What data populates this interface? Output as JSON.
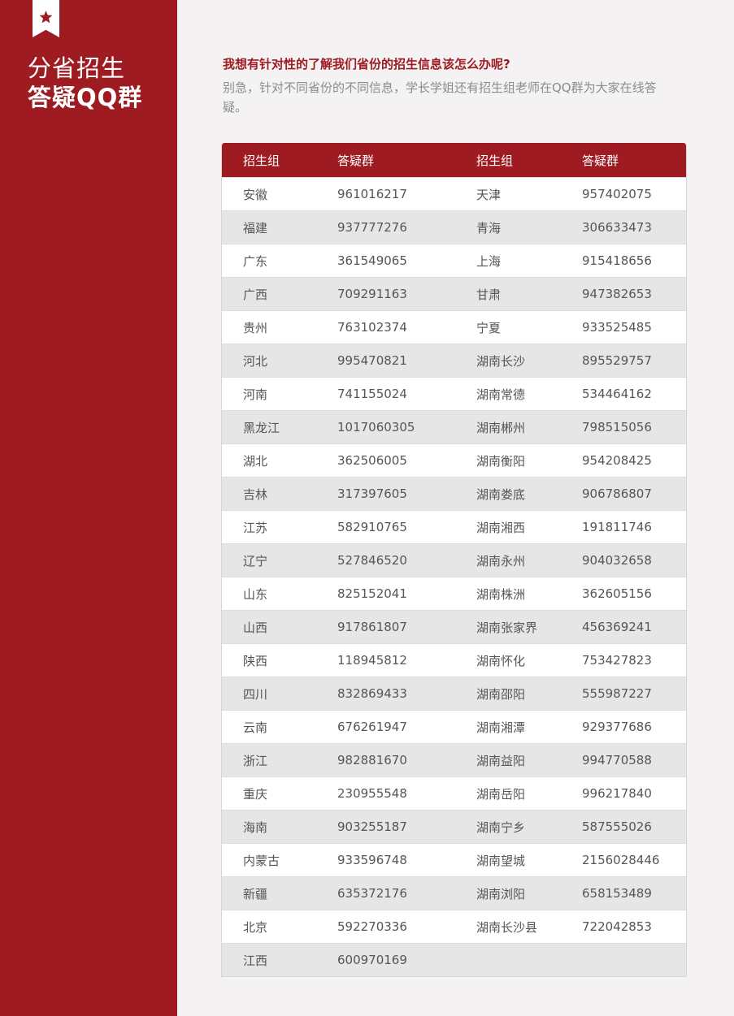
{
  "sidebar": {
    "title_line1": "分省招生",
    "title_line2": "答疑QQ群",
    "bookmark_icon": "star-icon",
    "accent_color": "#9e1b22"
  },
  "intro": {
    "question": "我想有针对性的了解我们省份的招生信息该怎么办呢?",
    "answer": "别急，针对不同省份的不同信息，学长学姐还有招生组老师在QQ群为大家在线答疑。"
  },
  "table": {
    "headers": [
      "招生组",
      "答疑群",
      "招生组",
      "答疑群"
    ],
    "rows": [
      [
        "安徽",
        "961016217",
        "天津",
        "957402075"
      ],
      [
        "福建",
        "937777276",
        "青海",
        "306633473"
      ],
      [
        "广东",
        "361549065",
        "上海",
        "915418656"
      ],
      [
        "广西",
        "709291163",
        "甘肃",
        "947382653"
      ],
      [
        "贵州",
        "763102374",
        "宁夏",
        "933525485"
      ],
      [
        "河北",
        "995470821",
        "湖南长沙",
        "895529757"
      ],
      [
        "河南",
        "741155024",
        "湖南常德",
        "534464162"
      ],
      [
        "黑龙江",
        "1017060305",
        "湖南郴州",
        "798515056"
      ],
      [
        "湖北",
        "362506005",
        "湖南衡阳",
        "954208425"
      ],
      [
        "吉林",
        "317397605",
        "湖南娄底",
        "906786807"
      ],
      [
        "江苏",
        "582910765",
        "湖南湘西",
        "191811746"
      ],
      [
        "辽宁",
        "527846520",
        "湖南永州",
        "904032658"
      ],
      [
        "山东",
        "825152041",
        "湖南株洲",
        "362605156"
      ],
      [
        "山西",
        "917861807",
        "湖南张家界",
        "456369241"
      ],
      [
        "陕西",
        "118945812",
        "湖南怀化",
        "753427823"
      ],
      [
        "四川",
        "832869433",
        "湖南邵阳",
        "555987227"
      ],
      [
        "云南",
        "676261947",
        "湖南湘潭",
        "929377686"
      ],
      [
        "浙江",
        "982881670",
        "湖南益阳",
        "994770588"
      ],
      [
        "重庆",
        "230955548",
        "湖南岳阳",
        "996217840"
      ],
      [
        "海南",
        "903255187",
        "湖南宁乡",
        "587555026"
      ],
      [
        "内蒙古",
        "933596748",
        "湖南望城",
        "2156028446"
      ],
      [
        "新疆",
        "635372176",
        "湖南浏阳",
        "658153489"
      ],
      [
        "北京",
        "592270336",
        "湖南长沙县",
        "722042853"
      ],
      [
        "江西",
        "600970169",
        "",
        ""
      ]
    ]
  }
}
